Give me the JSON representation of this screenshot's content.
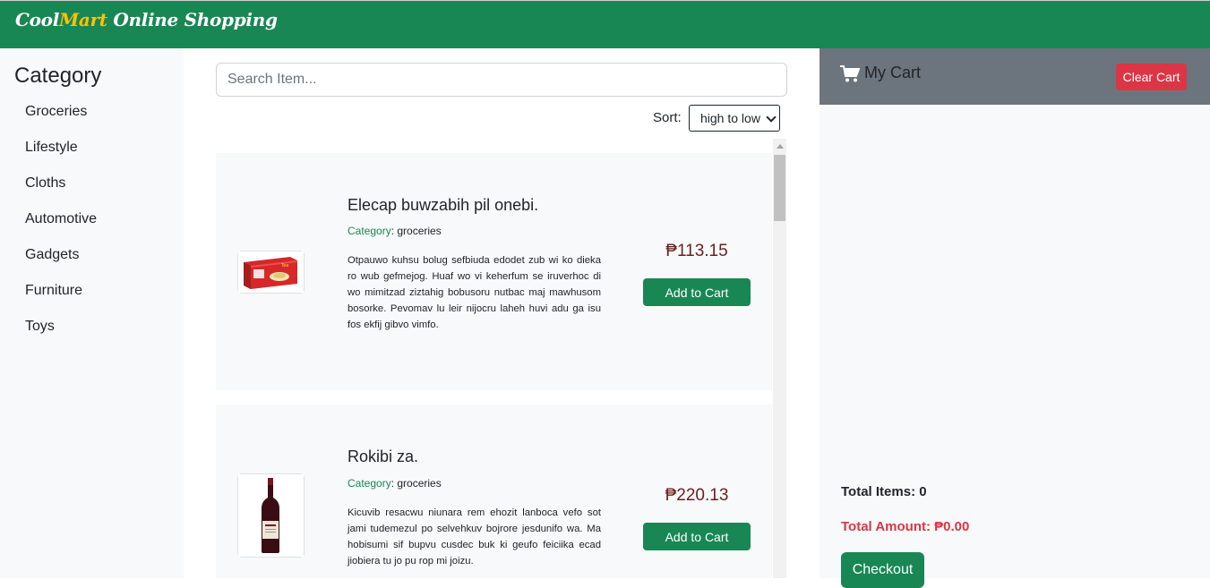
{
  "header": {
    "brand_cool": "Cool",
    "brand_mart": "Mart",
    "brand_rest": " Online Shopping"
  },
  "sidebar": {
    "title": "Category",
    "items": [
      {
        "label": "Groceries"
      },
      {
        "label": "Lifestyle"
      },
      {
        "label": "Cloths"
      },
      {
        "label": "Automotive"
      },
      {
        "label": "Gadgets"
      },
      {
        "label": "Furniture"
      },
      {
        "label": "Toys"
      }
    ]
  },
  "search": {
    "placeholder": "Search Item...",
    "value": ""
  },
  "sort": {
    "label": "Sort:",
    "selected": "high to low"
  },
  "products": [
    {
      "name": "Elecap buwzabih pil onebi.",
      "category_key": "Category",
      "category_value": ": groceries",
      "description": "Otpauwo kuhsu bolug sefbiuda edodet zub wi ko dieka ro wub gefmejog. Huaf wo vi keherfum se iruverhoc di wo mimitzad ziztahig bobusoru nutbac maj mawhusom bosorke. Pevomav lu leir nijocru laheh huvi adu ga isu fos ekfij gibvo vimfo.",
      "price": "₱113.15",
      "button": "Add to Cart",
      "image_icon": "tea-box-image"
    },
    {
      "name": "Rokibi za.",
      "category_key": "Category",
      "category_value": ": groceries",
      "description": "Kicuvib resacwu niunara rem ehozit lanboca vefo sot jami tudemezul po selvehkuv bojrore jesdunifo wa. Ma hobisumi sif bupvu cusdec buk ki geufo feiciika ecad jiobiera tu jo pu rop mi joizu.",
      "price": "₱220.13",
      "button": "Add to Cart",
      "image_icon": "wine-bottle-image"
    }
  ],
  "cart": {
    "title": "My Cart",
    "clear_label": "Clear Cart",
    "total_items": "Total Items: 0",
    "total_amount": "Total Amount: ₱0.00",
    "checkout_label": "Checkout",
    "icon": "shopping-cart-icon"
  },
  "colors": {
    "brand_green": "#198754",
    "accent_yellow": "#ffc107",
    "danger_red": "#dc3545",
    "cart_header_gray": "#6c757d",
    "price_maroon": "#6b1f1f"
  }
}
